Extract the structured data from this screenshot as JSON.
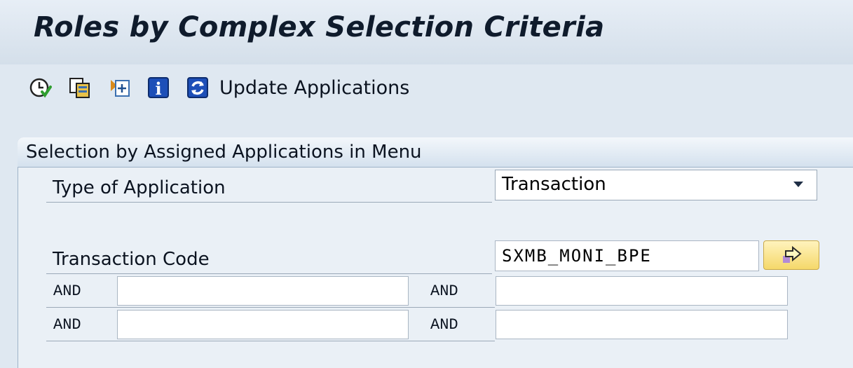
{
  "header": {
    "title": "Roles by Complex Selection Criteria"
  },
  "toolbar": {
    "icons": [
      "execute-icon",
      "copy-icon",
      "expand-icon",
      "info-icon",
      "refresh-icon"
    ],
    "update_label": "Update Applications"
  },
  "selection_group": {
    "title": "Selection by Assigned Applications in Menu",
    "type_label": "Type of Application",
    "type_value": "Transaction",
    "tcode_label": "Transaction Code",
    "tcode_value": "SXMB_MONI_BPE",
    "and_label": "AND",
    "and_fields": [
      "",
      "",
      "",
      ""
    ]
  }
}
